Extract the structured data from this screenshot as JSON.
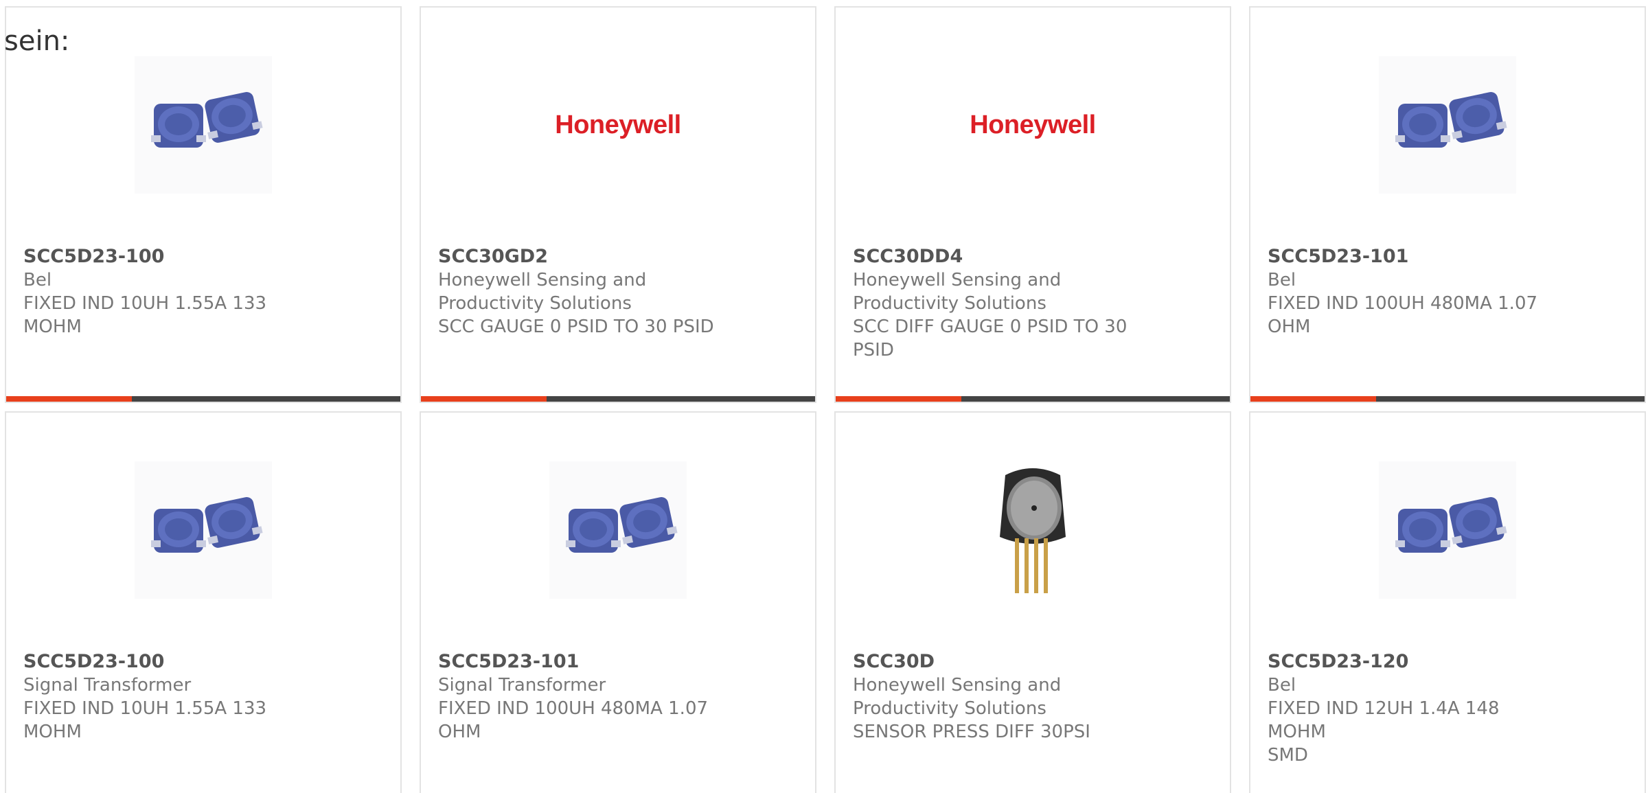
{
  "intro_text": "sein:",
  "colors": {
    "accent": "#e8401c",
    "bar": "#444444",
    "brand_honeywell": "#dc1f26"
  },
  "products": [
    {
      "part": "SCC5D23-100",
      "manufacturer": "Bel",
      "desc1": "FIXED IND 10UH 1.55A 133",
      "desc2": "MOHM",
      "image": "inductor-image"
    },
    {
      "part": "SCC30GD2",
      "manufacturer": "Honeywell Sensing and",
      "manufacturer2": "Productivity Solutions",
      "desc1": "SCC GAUGE 0 PSID TO 30 PSID",
      "desc2": "",
      "image": "honeywell-logo",
      "logo_text": "Honeywell"
    },
    {
      "part": "SCC30DD4",
      "manufacturer": "Honeywell Sensing and",
      "manufacturer2": "Productivity Solutions",
      "desc1": "SCC DIFF GAUGE 0 PSID TO 30",
      "desc2": "PSID",
      "image": "honeywell-logo",
      "logo_text": "Honeywell"
    },
    {
      "part": "SCC5D23-101",
      "manufacturer": "Bel",
      "desc1": "FIXED IND 100UH 480MA 1.07",
      "desc2": "OHM",
      "image": "inductor-image"
    },
    {
      "part": "SCC5D23-100",
      "manufacturer": "Signal Transformer",
      "desc1": "FIXED IND 10UH 1.55A 133",
      "desc2": "MOHM",
      "image": "inductor-image"
    },
    {
      "part": "SCC5D23-101",
      "manufacturer": "Signal Transformer",
      "desc1": "FIXED IND 100UH 480MA 1.07",
      "desc2": "OHM",
      "image": "inductor-image"
    },
    {
      "part": "SCC30D",
      "manufacturer": "Honeywell Sensing and",
      "manufacturer2": "Productivity Solutions",
      "desc1": "SENSOR PRESS DIFF 30PSI",
      "desc2": "",
      "image": "pressure-sensor-image"
    },
    {
      "part": "SCC5D23-120",
      "manufacturer": "Bel",
      "desc1": "FIXED IND 12UH 1.4A 148 MOHM",
      "desc2": "SMD",
      "image": "inductor-image"
    }
  ]
}
